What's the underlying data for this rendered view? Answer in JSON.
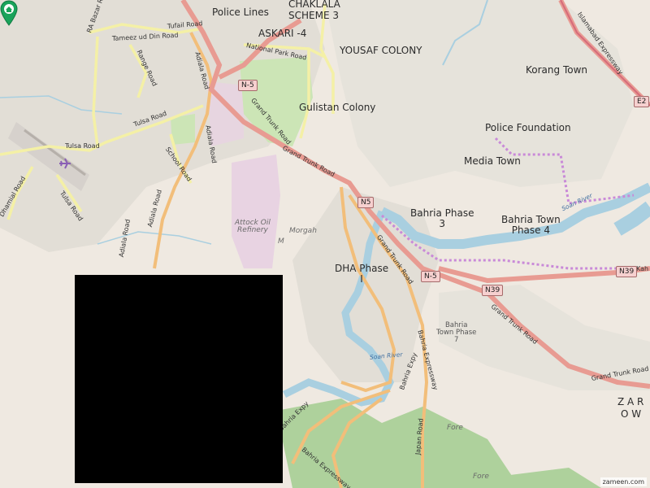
{
  "map": {
    "areas": {
      "police_lines": "Police Lines",
      "chaklala": "CHAKLALA",
      "scheme3": "SCHEME 3",
      "askari4": "ASKARI -4",
      "yousaf_colony": "YOUSAF COLONY",
      "korang_town": "Korang Town",
      "gulistan_colony": "Gulistan Colony",
      "police_foundation": "Police Foundation",
      "media_town": "Media Town",
      "bahria_phase3_a": "Bahria Phase",
      "bahria_phase3_b": "3",
      "bahria_phase4_a": "Bahria Town",
      "bahria_phase4_b": "Phase 4",
      "dha_a": "DHA Phase",
      "dha_b": "I",
      "bahria_phase7_a": "Bahria",
      "bahria_phase7_b": "Town Phase",
      "bahria_phase7_c": "7",
      "zara": "Z A R",
      "owi": "O W",
      "fore1": "Fore",
      "fore2": "Fore"
    },
    "places": {
      "attock_a": "Attock Oil",
      "attock_b": "Refinery",
      "morgah": "Morgah",
      "m": "M"
    },
    "roads": {
      "tameez": "Tameez ud Din Road",
      "tufail": "Tufail Road",
      "range_road": "Range Road",
      "adiala_top": "Adiala Road",
      "national_park": "National Park Road",
      "gt_road1": "Grand Trunk Road",
      "gt_road2": "Grand Trunk Road",
      "gt_road3": "Grand Trunk Road",
      "gt_road4": "Grand Trunk Road",
      "tulsa_a": "Tulsa Road",
      "tulsa_b": "Tulsa Road",
      "tulsa_c": "Tulsa Road",
      "school_road": "School Road",
      "adiala_road2": "Adiala Road",
      "adiala_road3": "Adiala Road",
      "adiala_road4": "Adiala Road",
      "dhamial": "Dhamial Road",
      "rabazar": "RA Bazar Road",
      "bahria_expy1": "Bahria Expressway",
      "bahria_expy2": "Bahria Expy",
      "bahria_expy3": "Bahria Expy",
      "bahria_expy4": "Bahria Expressway",
      "japan_road": "Japan Road",
      "islamabad_expy": "Islamabad Expressway",
      "kahuta": "Kah"
    },
    "shields": {
      "n5_a": "N-5",
      "n5_b": "N5",
      "n5_c": "N-5",
      "n39_a": "N39",
      "n39_b": "N39",
      "e2": "E2"
    },
    "water": {
      "soan1": "Soan River",
      "soan2": "Soan River"
    },
    "watermark": "zameen.com",
    "pin_icon": "home-location-pin",
    "colors": {
      "land": "#efe9e1",
      "urban": "#ddd9d2",
      "park": "#cce5b6",
      "forest": "#aed19c",
      "water": "#a9cfe0",
      "primary_road": "#e89b92",
      "secondary_road": "#f2be7a",
      "tertiary_road": "#f4f0a6",
      "boundary": "#c98ad8",
      "industrial": "#e8d3e2",
      "pin": "#1aa35b",
      "redaction": "#000000"
    }
  }
}
